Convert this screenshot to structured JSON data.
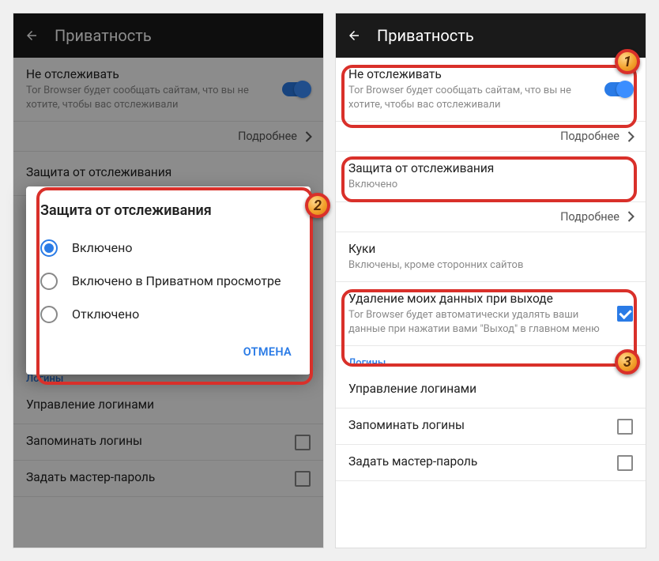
{
  "left": {
    "header": {
      "title": "Приватность"
    },
    "dnt": {
      "title": "Не отслеживать",
      "sub": "Tor Browser будет сообщать сайтам, что вы не хотите, чтобы вас отслеживали"
    },
    "more": "Подробнее",
    "tracking": {
      "title": "Защита от отслеживания"
    },
    "logins_heading": "Логины",
    "manage_logins": "Управление логинами",
    "remember_logins": "Запоминать логины",
    "master_password": "Задать мастер-пароль",
    "dialog": {
      "title": "Защита от отслеживания",
      "options": [
        "Включено",
        "Включено в Приватном просмотре",
        "Отключено"
      ],
      "cancel": "ОТМЕНА"
    }
  },
  "right": {
    "header": {
      "title": "Приватность"
    },
    "dnt": {
      "title": "Не отслеживать",
      "sub": "Tor Browser будет сообщать сайтам, что вы не хотите, чтобы вас отслеживали"
    },
    "more": "Подробнее",
    "tracking": {
      "title": "Защита от отслеживания",
      "sub": "Включено"
    },
    "cookies": {
      "title": "Куки",
      "sub": "Включены, кроме сторонних сайтов"
    },
    "clear_on_exit": {
      "title": "Удаление моих данных при выходе",
      "sub": "Tor Browser будет автоматически удалять ваши данные при нажатии вами \"Выход\" в главном меню"
    },
    "logins_heading": "Логины",
    "manage_logins": "Управление логинами",
    "remember_logins": "Запоминать логины",
    "master_password": "Задать мастер-пароль"
  },
  "badges": {
    "one": "1",
    "two": "2",
    "three": "3"
  }
}
